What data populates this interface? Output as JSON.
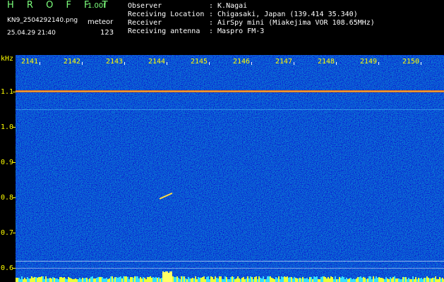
{
  "header": {
    "app_title": "H R O F F T",
    "version": "1.00f",
    "filename": "KN9_2504292140.png",
    "mode": "meteor",
    "datetime": "25.04.29 21:40",
    "count": "123",
    "info": [
      {
        "label": "Observer",
        "value": ": K.Nagai"
      },
      {
        "label": "Receiving Location",
        "value": ": Chigasaki, Japan (139.414 35.340)"
      },
      {
        "label": "Receiver",
        "value": ": AirSpy mini (Miakejima VOR 108.65MHz)"
      },
      {
        "label": "Receiving antenna",
        "value": ": Maspro FM-3"
      }
    ]
  },
  "spectrogram": {
    "unit_label": "kHz",
    "time_labels": [
      "2141",
      "2142",
      "2143",
      "2144",
      "2145",
      "2146",
      "2147",
      "2148",
      "2149",
      "2150"
    ],
    "freq_labels": [
      "1.1",
      "1.0",
      "0.9",
      "0.8",
      "0.7",
      "0.6"
    ],
    "colors": {
      "background": "#1a23b8",
      "tick": "#ffff00",
      "carrier": "#ff6a00"
    }
  }
}
